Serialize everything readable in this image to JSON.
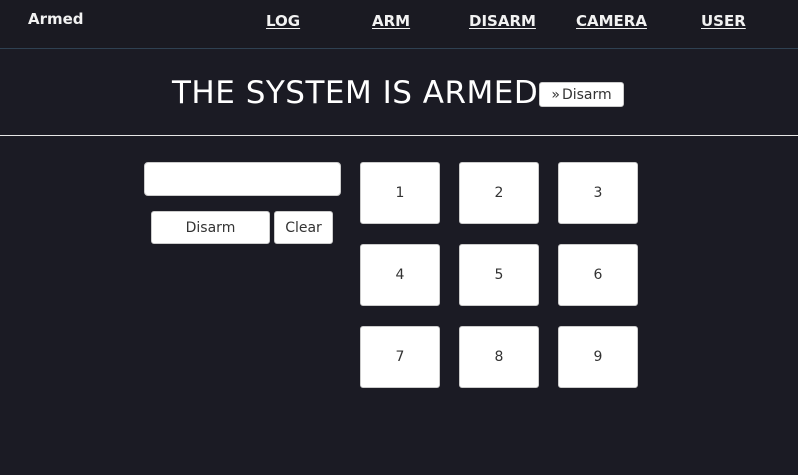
{
  "nav": {
    "brand": "Armed",
    "links": [
      "LOG",
      "ARM",
      "DISARM",
      "CAMERA",
      "USER"
    ]
  },
  "status": {
    "title": "THE SYSTEM IS ARMED",
    "button_label": "Disarm"
  },
  "keypad": {
    "code_value": "",
    "disarm_label": "Disarm",
    "clear_label": "Clear",
    "keys": [
      "1",
      "2",
      "3",
      "4",
      "5",
      "6",
      "7",
      "8",
      "9"
    ]
  }
}
